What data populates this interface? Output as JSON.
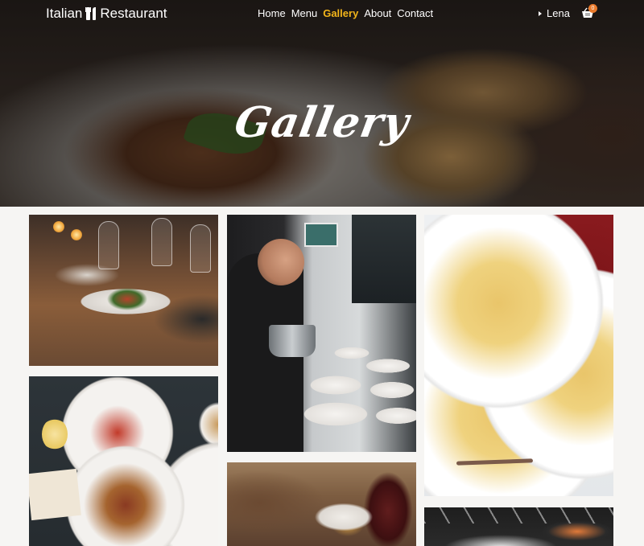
{
  "nav": {
    "brand_left": "Italian",
    "brand_right": "Restaurant",
    "links": [
      {
        "label": "Home",
        "active": false
      },
      {
        "label": "Menu",
        "active": false
      },
      {
        "label": "Gallery",
        "active": true
      },
      {
        "label": "About",
        "active": false
      },
      {
        "label": "Contact",
        "active": false
      }
    ],
    "user_name": "Lena",
    "cart_count": "0"
  },
  "hero": {
    "title": "Gallery"
  },
  "gallery": {
    "photos": [
      {
        "name": "restaurant-table-dinner"
      },
      {
        "name": "chef-plating-dishes"
      },
      {
        "name": "pasta-plates-with-wine"
      },
      {
        "name": "table-topdown-meal"
      },
      {
        "name": "plate-with-red-wine"
      },
      {
        "name": "sushi-on-dark-table"
      }
    ]
  },
  "colors": {
    "accent": "#f2b51a",
    "badge": "#e8792b",
    "page_background": "#f6f5f3"
  },
  "icons": [
    "cutlery-icon",
    "caret-right-icon",
    "shopping-basket-icon"
  ]
}
